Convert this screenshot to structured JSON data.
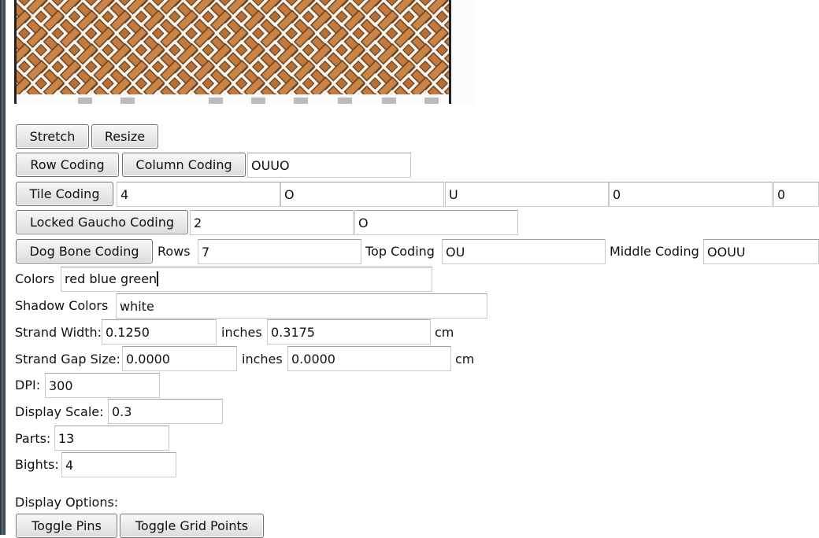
{
  "buttons": {
    "stretch": "Stretch",
    "resize": "Resize",
    "row_coding": "Row Coding",
    "column_coding": "Column Coding",
    "tile_coding": "Tile Coding",
    "locked_gaucho_coding": "Locked Gaucho Coding",
    "dog_bone_coding": "Dog Bone Coding",
    "toggle_pins": "Toggle Pins",
    "toggle_grid_points": "Toggle Grid Points"
  },
  "column_coding_value": "OUUO",
  "tile_coding": {
    "values": [
      "4",
      "O",
      "U",
      "0",
      "0"
    ]
  },
  "locked_gaucho": {
    "values": [
      "2",
      "O"
    ]
  },
  "dog_bone": {
    "rows_label": "Rows",
    "rows_value": "7",
    "top_coding_label": "Top Coding",
    "top_coding_value": "OU",
    "middle_coding_label": "Middle Coding",
    "middle_coding_value": "OOUU"
  },
  "colors": {
    "label": "Colors",
    "value": "red blue green"
  },
  "shadow_colors": {
    "label": "Shadow Colors",
    "value": "white"
  },
  "strand_width": {
    "label": "Strand Width:",
    "inches": "0.1250",
    "inches_unit": "inches",
    "cm": "0.3175",
    "cm_unit": "cm"
  },
  "strand_gap": {
    "label": "Strand Gap Size:",
    "inches": "0.0000",
    "inches_unit": "inches",
    "cm": "0.0000",
    "cm_unit": "cm"
  },
  "dpi": {
    "label": "DPI:",
    "value": "300"
  },
  "display_scale": {
    "label": "Display Scale:",
    "value": "0.3"
  },
  "parts": {
    "label": "Parts:",
    "value": "13"
  },
  "bights": {
    "label": "Bights:",
    "value": "4"
  },
  "display_options_label": "Display Options:",
  "colors_theme": {
    "strand": "#c47a3c",
    "strand_edge": "#6b3e1c",
    "page": "#ffffff"
  }
}
